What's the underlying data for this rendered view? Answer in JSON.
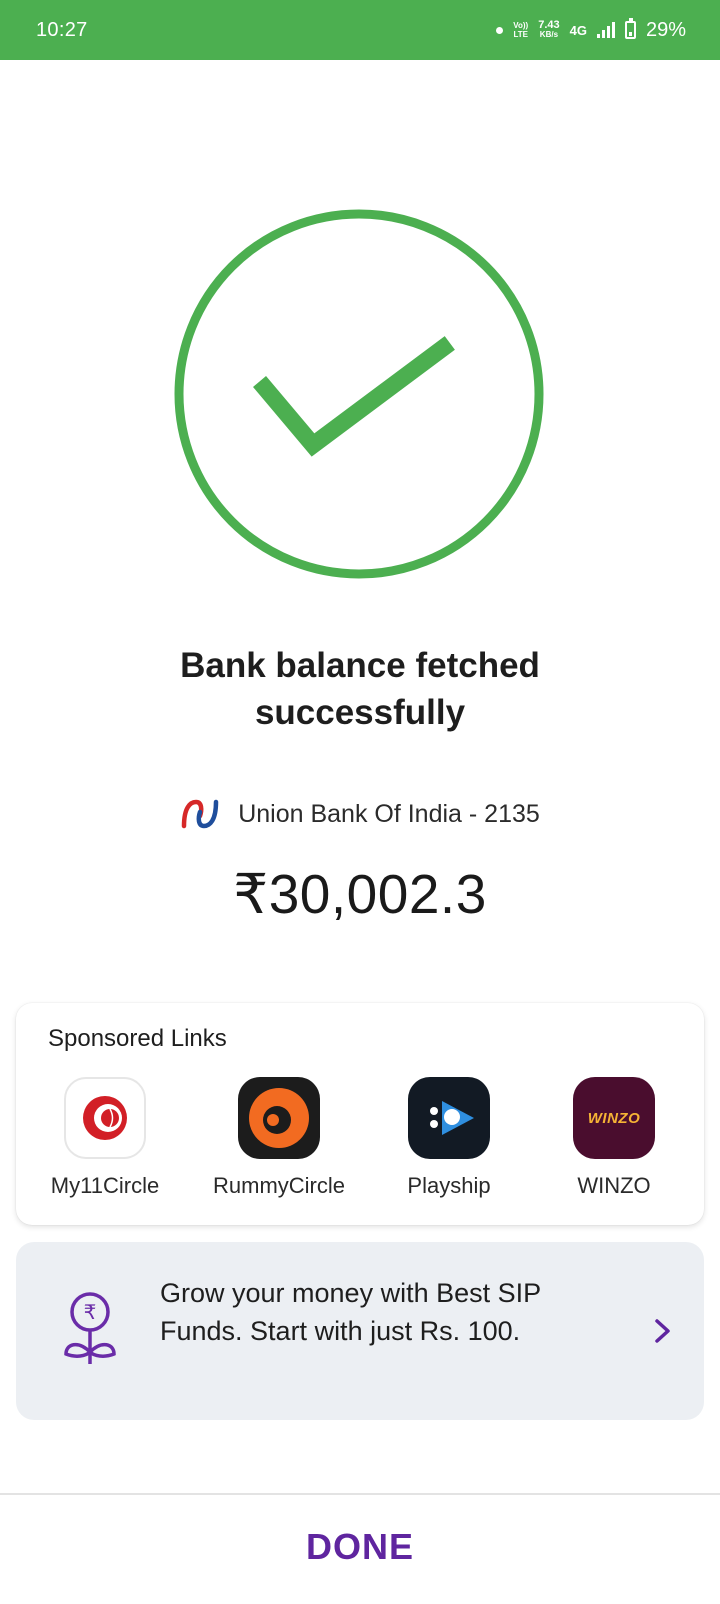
{
  "status_bar": {
    "time": "10:27",
    "volte_top": "Vo))",
    "volte_bottom": "LTE",
    "speed_value": "7.43",
    "speed_unit": "KB/s",
    "network": "4G",
    "battery": "29%"
  },
  "result": {
    "headline_line1": "Bank balance fetched",
    "headline_line2": "successfully",
    "bank_name": "Union Bank Of India - 2135",
    "balance": "₹30,002.3"
  },
  "sponsored": {
    "title": "Sponsored Links",
    "items": [
      {
        "label": "My11Circle",
        "icon": "my11circle-icon"
      },
      {
        "label": "RummyCircle",
        "icon": "rummycircle-icon"
      },
      {
        "label": "Playship",
        "icon": "playship-icon"
      },
      {
        "label": "WINZO",
        "icon": "winzo-icon",
        "icon_text": "WINZO"
      }
    ]
  },
  "sip_promo": {
    "text": "Grow your money with Best SIP Funds. Start with just Rs. 100.",
    "icon": "money-plant-icon"
  },
  "footer": {
    "done_label": "DONE"
  },
  "colors": {
    "status_bar": "#4caf50",
    "success_green": "#4caf50",
    "brand_purple": "#5f259f",
    "card_gray": "#eceff3"
  }
}
